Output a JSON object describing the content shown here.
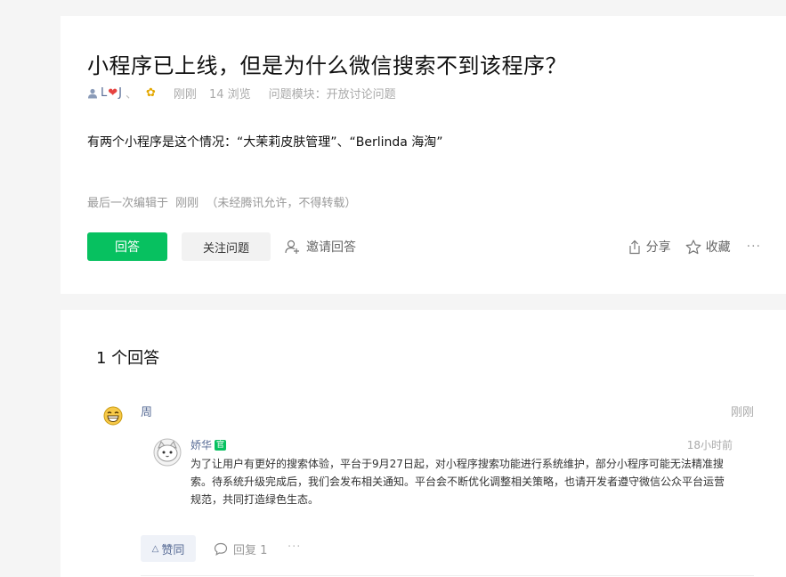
{
  "question": {
    "title": "小程序已上线，但是为什么微信搜索不到该程序？",
    "author_prefix": "L",
    "author_suffix": "J",
    "author_sep": "、",
    "time": "刚刚",
    "views": "14 浏览",
    "module_label": "问题模块：",
    "module_value": "开放讨论问题",
    "body": "有两个小程序是这个情况：“大茉莉皮肤管理”、“Berlinda 海淘”",
    "edit_note_prefix": "最后一次编辑于",
    "edit_note_time": "刚刚",
    "edit_note_suffix": "（未经腾讯允许，不得转载）"
  },
  "actions": {
    "answer_label": "回答",
    "follow_label": "关注问题",
    "invite_label": "邀请回答",
    "share_label": "分享",
    "favorite_label": "收藏",
    "more_label": "···"
  },
  "answers": {
    "count_label": "1 个回答",
    "items": [
      {
        "author": "周",
        "time": "刚刚",
        "reply": {
          "name": "娇华",
          "badge": "官",
          "time": "18小时前",
          "text": "为了让用户有更好的搜索体验，平台于9月27日起，对小程序搜索功能进行系统维护，部分小程序可能无法精准搜索。待系统升级完成后，我们会发布相关通知。平台会不断优化调整相关策略，也请开发者遵守微信公众平台运营规范，共同打造绿色生态。"
        },
        "like_label": "赞同",
        "reply_label": "回复 1",
        "more_label": "···"
      }
    ]
  },
  "colors": {
    "accent_green": "#07c160",
    "link_blue": "#576b95",
    "muted": "#999999"
  }
}
